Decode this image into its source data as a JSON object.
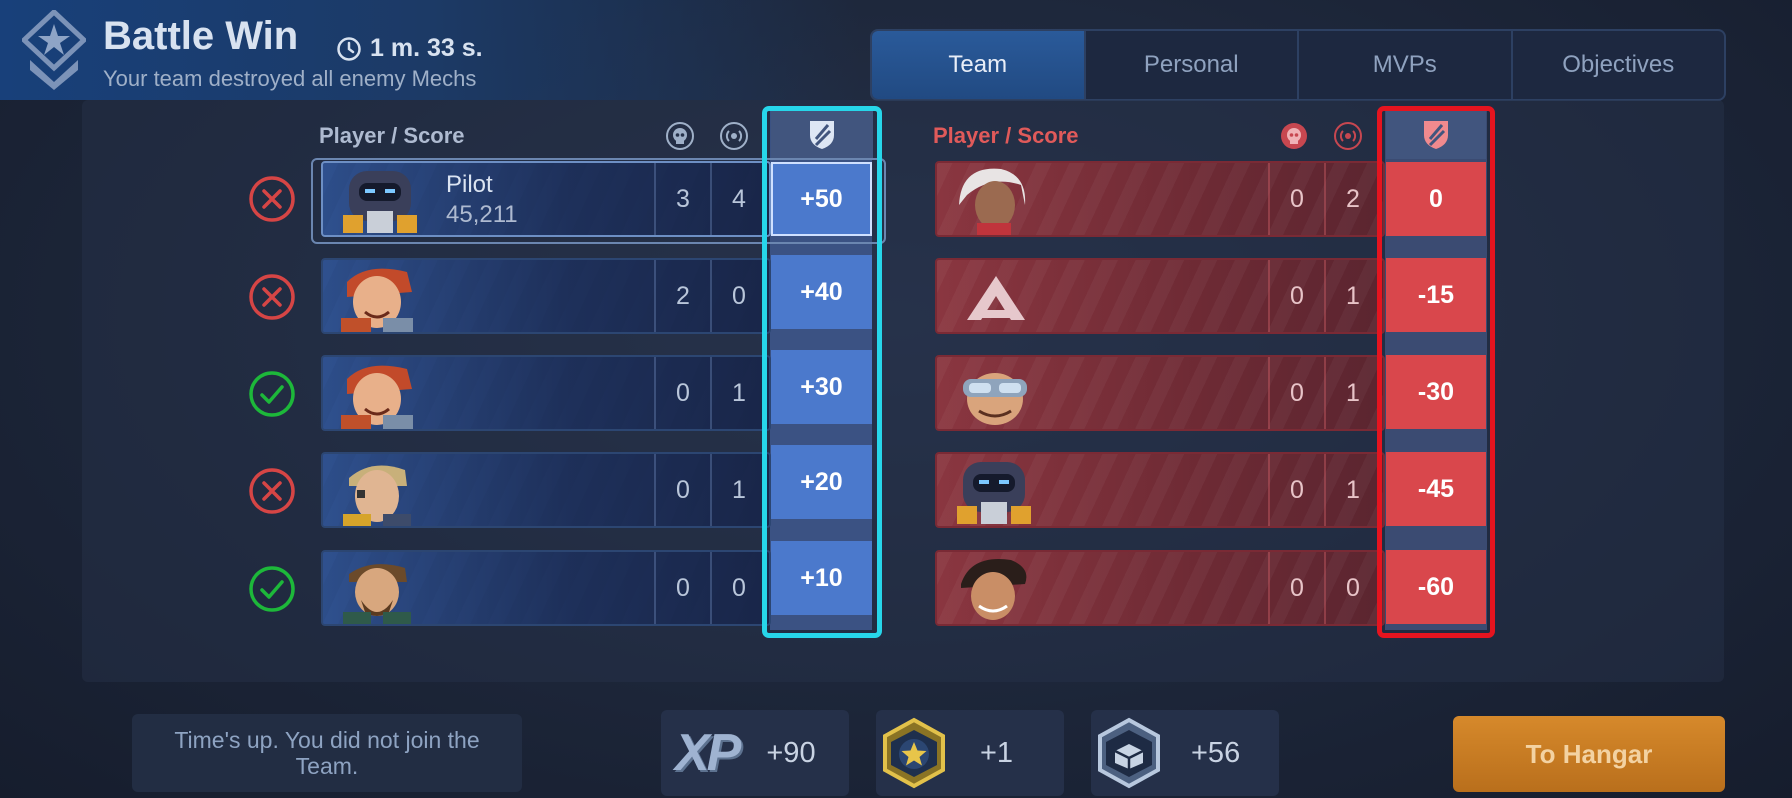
{
  "header": {
    "title": "Battle Win",
    "duration": "1 m. 33 s.",
    "subtitle": "Your team destroyed all enemy Mechs"
  },
  "tabs": [
    {
      "label": "Team",
      "active": true
    },
    {
      "label": "Personal",
      "active": false
    },
    {
      "label": "MVPs",
      "active": false
    },
    {
      "label": "Objectives",
      "active": false
    }
  ],
  "left_team": {
    "header": "Player / Score",
    "players": [
      {
        "name": "Pilot",
        "score": "45,211",
        "kills": "3",
        "assists": "4",
        "points": "+50",
        "status": "defeated"
      },
      {
        "name": "",
        "score": "",
        "kills": "2",
        "assists": "0",
        "points": "+40",
        "status": "defeated"
      },
      {
        "name": "",
        "score": "",
        "kills": "0",
        "assists": "1",
        "points": "+30",
        "status": "survived"
      },
      {
        "name": "",
        "score": "",
        "kills": "0",
        "assists": "1",
        "points": "+20",
        "status": "defeated"
      },
      {
        "name": "",
        "score": "",
        "kills": "0",
        "assists": "0",
        "points": "+10",
        "status": "survived"
      }
    ]
  },
  "right_team": {
    "header": "Player / Score",
    "players": [
      {
        "kills": "0",
        "assists": "2",
        "points": "0"
      },
      {
        "kills": "0",
        "assists": "1",
        "points": "-15"
      },
      {
        "kills": "0",
        "assists": "1",
        "points": "-30"
      },
      {
        "kills": "0",
        "assists": "1",
        "points": "-45"
      },
      {
        "kills": "0",
        "assists": "0",
        "points": "-60"
      }
    ]
  },
  "footer": {
    "notice": "Time's up. You did not join the Team.",
    "xp_label": "XP",
    "xp_value": "+90",
    "star_value": "+1",
    "crate_value": "+56",
    "hangar_button": "To Hangar"
  },
  "colors": {
    "team_accent": "#27d6ea",
    "enemy_accent": "#e5141f",
    "score_positive": "#4b79cc",
    "score_negative": "#d9474c",
    "hangar": "#d6892b",
    "status_ok": "#1db83a",
    "status_fail": "#d64545"
  }
}
